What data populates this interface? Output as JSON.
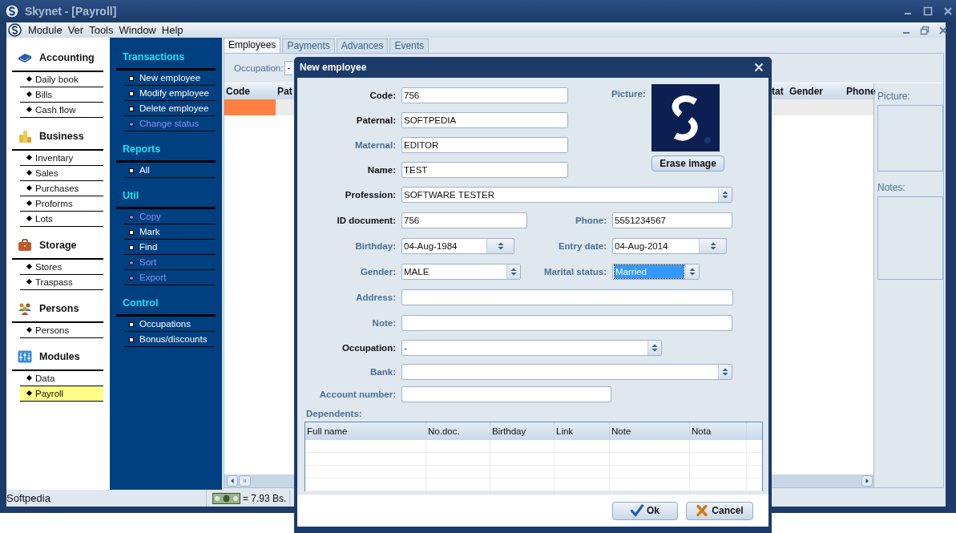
{
  "window": {
    "title": "Skynet - [Payroll]"
  },
  "menu": [
    "Module",
    "Ver",
    "Tools",
    "Window",
    "Help"
  ],
  "sidebar": {
    "groups": [
      {
        "title": "Accounting",
        "kind": "book",
        "items": [
          {
            "label": "Daily book",
            "selected": false
          },
          {
            "label": "Bills",
            "selected": false
          },
          {
            "label": "Cash flow",
            "selected": false
          }
        ]
      },
      {
        "title": "Business",
        "kind": "coins",
        "items": [
          {
            "label": "Inventary",
            "selected": false
          },
          {
            "label": "Sales",
            "selected": false
          },
          {
            "label": "Purchases",
            "selected": false
          },
          {
            "label": "Proforms",
            "selected": false
          },
          {
            "label": "Lots",
            "selected": false
          }
        ]
      },
      {
        "title": "Storage",
        "kind": "briefcase",
        "items": [
          {
            "label": "Stores",
            "selected": false
          },
          {
            "label": "Traspass",
            "selected": false
          }
        ]
      },
      {
        "title": "Persons",
        "kind": "people",
        "items": [
          {
            "label": "Persons",
            "selected": false
          }
        ]
      },
      {
        "title": "Modules",
        "kind": "panel",
        "items": [
          {
            "label": "Data",
            "selected": false
          },
          {
            "label": "Payroll",
            "selected": true
          }
        ]
      }
    ]
  },
  "actions": {
    "sections": [
      {
        "title": "Transactions",
        "items": [
          {
            "label": "New employee",
            "disabled": false
          },
          {
            "label": "Modify employee",
            "disabled": false
          },
          {
            "label": "Delete employee",
            "disabled": false
          },
          {
            "label": "Change status",
            "disabled": true
          }
        ]
      },
      {
        "title": "Reports",
        "items": [
          {
            "label": "All",
            "disabled": false
          }
        ]
      },
      {
        "title": "Util",
        "items": [
          {
            "label": "Copy",
            "disabled": true
          },
          {
            "label": "Mark",
            "disabled": false
          },
          {
            "label": "Find",
            "disabled": false
          },
          {
            "label": "Sort",
            "disabled": true
          },
          {
            "label": "Export",
            "disabled": true
          }
        ]
      },
      {
        "title": "Control",
        "items": [
          {
            "label": "Occupations",
            "disabled": false
          },
          {
            "label": "Bonus/discounts",
            "disabled": false
          }
        ]
      }
    ]
  },
  "tabs": [
    {
      "label": "Employees",
      "selected": true
    },
    {
      "label": "Payments",
      "selected": false
    },
    {
      "label": "Advances",
      "selected": false
    },
    {
      "label": "Events",
      "selected": false
    }
  ],
  "filter": {
    "label": "Occupation:",
    "value": "-"
  },
  "table": {
    "columns": [
      "Code",
      "Pat",
      "tat",
      "Gender",
      "Phone"
    ],
    "rows": [
      {
        "selected": true
      }
    ]
  },
  "details": {
    "picture_label": "Picture:",
    "notes_label": "Notes:"
  },
  "status_bar": {
    "text": "Softpedia",
    "rate": "= 7.93 Bs."
  },
  "dialog": {
    "title": "New employee",
    "picture_label": "Picture:",
    "erase_button": "Erase image",
    "rows": [
      [
        {
          "label": "Code:",
          "value": "756",
          "kind": "text",
          "required": true,
          "focused": false
        }
      ],
      [
        {
          "label": "Paternal:",
          "value": "SOFTPEDIA",
          "kind": "text",
          "required": true,
          "focused": false
        }
      ],
      [
        {
          "label": "Maternal:",
          "value": "EDITOR",
          "kind": "text",
          "required": false,
          "focused": false
        }
      ],
      [
        {
          "label": "Name:",
          "value": "TEST",
          "kind": "text",
          "required": true,
          "focused": false
        }
      ],
      [
        {
          "label": "Profession:",
          "value": "SOFTWARE TESTER",
          "kind": "select",
          "required": true,
          "focused": false
        }
      ],
      [
        {
          "label": "ID document:",
          "value": "756",
          "kind": "text",
          "required": true,
          "focused": false
        },
        {
          "label": "Phone:",
          "value": "5551234567",
          "kind": "text",
          "required": false,
          "focused": false
        }
      ],
      [
        {
          "label": "Birthday:",
          "value": "04-Aug-1984",
          "kind": "date",
          "required": false,
          "focused": false
        },
        {
          "label": "Entry date:",
          "value": "04-Aug-2014",
          "kind": "date",
          "required": false,
          "focused": false
        }
      ],
      [
        {
          "label": "Gender:",
          "value": "MALE",
          "kind": "select",
          "required": false,
          "focused": false
        },
        {
          "label": "Marital status:",
          "value": "Married",
          "kind": "select",
          "required": false,
          "focused": true
        }
      ],
      [
        {
          "label": "Address:",
          "kind": "text",
          "required": false,
          "focused": false
        }
      ],
      [
        {
          "label": "Note:",
          "kind": "text",
          "required": false,
          "focused": false
        }
      ],
      [
        {
          "label": "Occupation:",
          "value": "-",
          "kind": "select",
          "required": true,
          "focused": false
        }
      ],
      [
        {
          "label": "Bank:",
          "kind": "select",
          "required": false,
          "focused": false
        }
      ],
      [
        {
          "label": "Account number:",
          "kind": "text",
          "required": false,
          "focused": false
        }
      ]
    ],
    "dependents": {
      "label": "Dependents:",
      "columns": [
        "Full name",
        "No.doc.",
        "Birthday",
        "Link",
        "Note",
        "Nota"
      ]
    },
    "buttons": [
      {
        "label": "Ok",
        "kind": "ok"
      },
      {
        "label": "Cancel",
        "kind": "cancel"
      }
    ]
  }
}
